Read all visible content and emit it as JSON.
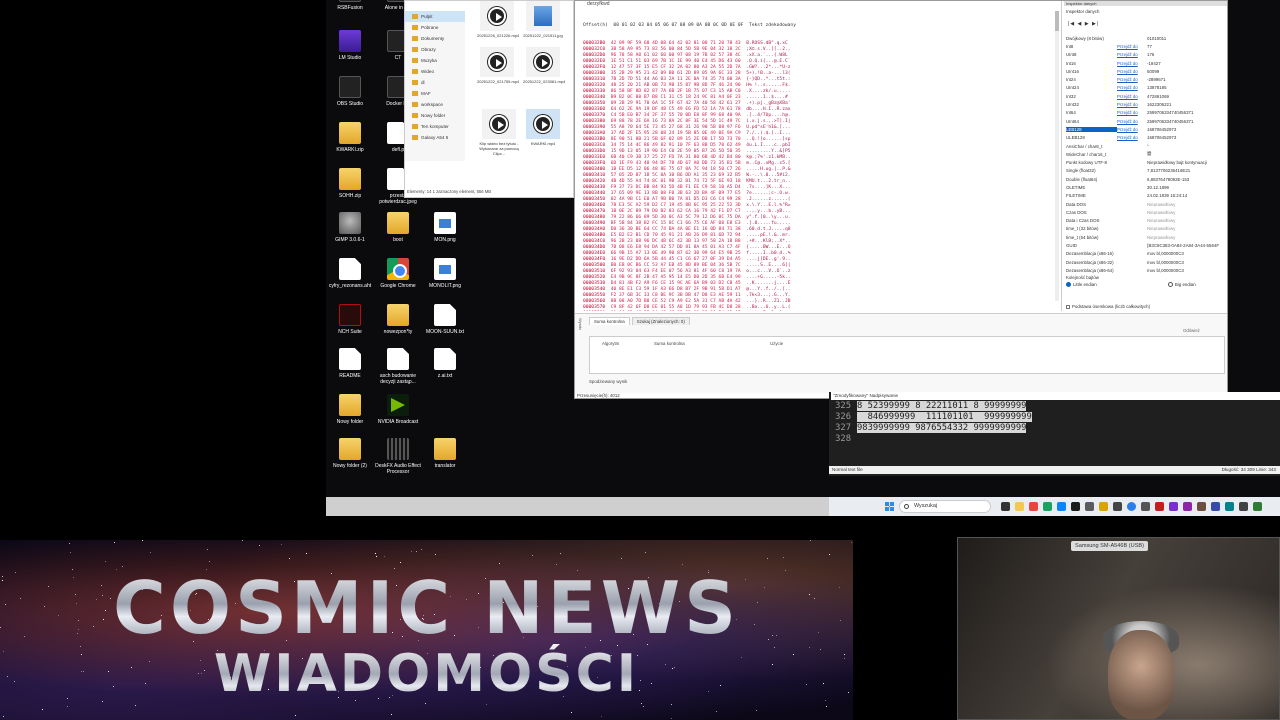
{
  "desktop": {
    "icons": [
      {
        "label": "RSBFusion",
        "kind": "dark"
      },
      {
        "label": "Alone in the",
        "kind": "dark"
      },
      {
        "label": "LM Studio",
        "kind": "purple"
      },
      {
        "label": "CT",
        "kind": "dark"
      },
      {
        "label": "OBS Studio",
        "kind": "dark"
      },
      {
        "label": "Docker De",
        "kind": "dark"
      },
      {
        "label": "KWARKI.zip",
        "kind": "folder"
      },
      {
        "label": "defl.p",
        "kind": "doc"
      },
      {
        "label": "SOHH.zip",
        "kind": "folder"
      },
      {
        "label": "przesta potwierdzac.jpeg",
        "kind": "doc"
      },
      {
        "label": "GIMP 3.0.6-1",
        "kind": "gimp"
      },
      {
        "label": "boot",
        "kind": "folder"
      },
      {
        "label": "MON.png",
        "kind": "img"
      },
      {
        "label": "cyfry_rezonans.aht",
        "kind": "doc"
      },
      {
        "label": "Google Chrome",
        "kind": "chrome"
      },
      {
        "label": "MONOLIT.png",
        "kind": "img"
      },
      {
        "label": "NCH Suite",
        "kind": "red"
      },
      {
        "label": "nowezpon*ty",
        "kind": "folder"
      },
      {
        "label": "MOON-SUUN.txt",
        "kind": "doc"
      },
      {
        "label": "README",
        "kind": "doc"
      },
      {
        "label": "asch budowanie decyzji zastąp...",
        "kind": "doc"
      },
      {
        "label": "z.ai.txt",
        "kind": "doc"
      },
      {
        "label": "Nowy folder",
        "kind": "folder"
      },
      {
        "label": "NVIDIA Broadcast",
        "kind": "green"
      },
      {
        "label": "Nowy folder (2)",
        "kind": "folder"
      },
      {
        "label": "DeskFX Audio Effect Processor",
        "kind": "eq"
      },
      {
        "label": "translator",
        "kind": "folder"
      }
    ]
  },
  "explorer": {
    "nav": [
      "Pulpit",
      "Pobrane",
      "Dokumenty",
      "Obrazy",
      "Muzyka",
      "Wideo",
      "dl",
      "MAF",
      "workspace",
      "Nowy folder",
      "Ten komputer",
      "Galaxy A54 5"
    ],
    "files": [
      {
        "label": "20251226_021226.mp4",
        "kind": "video"
      },
      {
        "label": "20251222_021511.jpg",
        "kind": "image"
      },
      {
        "label": "20251222_021755.mp4",
        "kind": "video"
      },
      {
        "label": "20251222_023081.mp4",
        "kind": "video"
      },
      {
        "label": "Klip wideo bez tytułu - Wykonane za pomocą Clipc...",
        "kind": "video"
      },
      {
        "label": "KWARKI.mp4",
        "kind": "video"
      }
    ],
    "status": "Elementy: 14    1 zaznaczony element, 556 MB"
  },
  "hexeditor": {
    "title": "derzyfkwd",
    "header": "Offset(h)  00 01 02 03 04 05 06 07 08 09 0A 0B 0C 0D 0E 0F  Tekst zdekodowany",
    "rows": [
      {
        "off": "000032B0",
        "hex": "42 09 9F 59 60 4D 08 64 42 02 81 00 71 20 78 43",
        "txt": "B.ROSS.dB\".q.xC"
      },
      {
        "off": "000032C0",
        "hex": "3B 58 A9 95 73 82 56 00 84 5D 5B 9E 04 32 18 2C",
        "txt": ";X©.s.V..][..2.,"
      },
      {
        "off": "000032D0",
        "hex": "96 78 58 A0 61 02 60 00 97 08 19 7B 02 57 38 4C",
        "txt": ".xX.a.`...{.W8L"
      },
      {
        "off": "000032E0",
        "hex": "1E 51 C1 51 03 69 7B 1C 1E 99 40 E4 45 D6 43 60",
        "txt": ".Q.Q.i{...@.E.C`"
      },
      {
        "off": "000032F0",
        "hex": "12 47 57 3F 15 E5 CF 32 2A 02 80 A3 2A 55 2D 7A",
        "txt": ".GW?...2*...*U-z"
      },
      {
        "off": "00003300",
        "hex": "35 2B 29 95 21 42 09 B0 61 2D 89 05 9A 6C 33 28",
        "txt": "5+).!B..a-...l3("
      },
      {
        "off": "00003310",
        "hex": "7B 2D 7D 51 44 A6 03 2A 11 2E 0A 74 35 74 00 3A",
        "txt": "{-}QD..*...t5t.:"
      },
      {
        "off": "00003320",
        "hex": "48 25 20 21 AB 0B 73 9B 15 87 9B 8D 7F 46 24 90",
        "txt": "H% !..s......F$."
      },
      {
        "off": "00003330",
        "hex": "86 58 BF 8D 82 87 7A 6B 2F 1B 75 07 C3 15 AB C0",
        "txt": ".X....zk/.u....."
      },
      {
        "off": "00003340",
        "hex": "B9 B2 0C 88 B7 B8 C1 31 C5 18 24 9C 81 A4 0F 23",
        "txt": "......1..$....#"
      },
      {
        "off": "00003350",
        "hex": "09 2B 29 91 70 6A 1C 5F 67 42 7A 40 58 42 61 27",
        "txt": ".+).pj._gBz@XBa'"
      },
      {
        "off": "00003360",
        "hex": "64 62 2E 9A 19 DF 48 C5 49 E6 FD 52 1A 7A 61 78",
        "txt": "db....H.I..R.zax"
      },
      {
        "off": "00003370",
        "hex": "C4 5B E0 B7 34 2F 37 55 70 0D E8 8F 99 68 40 9A",
        "txt": ".[..4/7Up....h@."
      },
      {
        "off": "00003380",
        "hex": "69 88 78 2E 6A 16 73 8A 2C 8F 3E 54 5D 1C 49 7C",
        "txt": "i.x.j.s.,.>T].I|"
      },
      {
        "off": "00003390",
        "hex": "55 A8 70 64 5E 73 45 27 68 31 26 90 5B 08 97 F6",
        "txt": "U.pd^sE'h1&.[..."
      },
      {
        "off": "000033A0",
        "hex": "37 AD 2F E5 95 28 08 24 19 5B 85 0E 49 0E 9A C9",
        "txt": "7./..(.$.[..I..."
      },
      {
        "off": "000033B0",
        "hex": "8E 90 51 8B 21 5B 6F 02 89 15 2E DB 17 5D 73 70",
        "txt": "..Q.![o......]sp"
      },
      {
        "off": "000033C0",
        "hex": "34 75 14 4C 86 49 82 91 10 7F 63 8B D5 70 62 49",
        "txt": "4u.L.I....c..pbI"
      },
      {
        "off": "000033D0",
        "hex": "15 9D 13 05 19 90 E4 C0 2E 59 05 B7 26 5D 50 35",
        "txt": ".........Y..&]P5"
      },
      {
        "off": "000033E0",
        "hex": "6B 40 C9 3B 37 25 27 FD 7A 31 80 6B 4D 42 B4 80",
        "txt": "k@.;7%'.z1.kMB.."
      },
      {
        "off": "000033F0",
        "hex": "6D 1E F9 43 40 94 DF 78 4D 67 A0 DD 73 35 B1 5B",
        "txt": "m..C@..xMg..s5.["
      },
      {
        "off": "00003400",
        "hex": "1B EE D5 12 06 48 8E 75 67 0A 7C 94 18 50 C7 26",
        "txt": ".....H.ug.|..P.&"
      },
      {
        "off": "00003410",
        "hex": "57 05 2D 87 18 5C 0A 30 B6 DD A1 35 23 69 32 B5",
        "txt": "W.-..\\.0...5#i2."
      },
      {
        "off": "00003420",
        "hex": "4B 4D 55 A4 74 8C 01 9B 32 B1 74 72 5F 6E 93 18",
        "txt": "KMU.t...2.tr_n.."
      },
      {
        "off": "00003430",
        "hex": "F9 37 73 DC BB 84 93 5D 4B F1 EE C9 58 10 A5 D4",
        "txt": ".7s....]K...X..."
      },
      {
        "off": "00003440",
        "hex": "37 65 09 9E 13 8B 08 F0 3B 63 2D BA 4F 09 77 E5",
        "txt": "7e......;c-.O.w."
      },
      {
        "off": "00003450",
        "hex": "02 4A 9B C1 E0 A7 9B B0 7A 81 D5 D3 C6 C4 99 28",
        "txt": ".J......z......("
      },
      {
        "off": "00003460",
        "hex": "78 E3 5C A2 59 D2 C7 19 45 8B 6C 95 25 22 52 3D",
        "txt": "x.\\.Y...E.l.%\"R="
      },
      {
        "off": "00003470",
        "hex": "1B 0E 2C 89 79 D0 B2 83 62 CA 16 79 42 F1 D7 C7",
        "txt": "..,.y...b..yB..."
      },
      {
        "off": "00003480",
        "hex": "79 22 86 66 89 5D 30 0C A3 5C 79 12 D6 0C 75 DA",
        "txt": "y\".f.]0..\\y...u."
      },
      {
        "off": "00003490",
        "hex": "BF 5B 84 38 B2 FC 15 8C C1 66 75 C6 AF 08 E8 E3",
        "txt": ".[.8.....fu....."
      },
      {
        "off": "000034A0",
        "hex": "D0 36 30 BE 64 CC 74 BA 4A 0E E1 16 0D 84 71 38",
        "txt": ".60.d.t.J.....q8"
      },
      {
        "off": "000034B0",
        "hex": "E5 B2 E2 B1 CD 70 45 91 21 AB 26 D9 81 6D 72 94",
        "txt": ".....pE.!.&..mr."
      },
      {
        "off": "000034C0",
        "hex": "96 2B 23 88 96 DC 4B 6C 42 3B 13 97 58 2A 18 B8",
        "txt": ".+#...KlB;..X*.."
      },
      {
        "off": "000034D0",
        "hex": "7B 08 E6 E8 94 DA 42 57 DD 81 8A 45 01 A3 C7 4F",
        "txt": "{.....BW...E...O"
      },
      {
        "off": "000034E0",
        "hex": "66 9B 15 A7 13 0E 49 90 87 62 30 99 64 E5 9B 25",
        "txt": "f.....I..b0.d..%"
      },
      {
        "off": "000034F0",
        "hex": "16 9E D2 DD 6A 5B 44 45 C1 C6 67 27 0F 39 D4 A5",
        "txt": "....j[DE..g'.9.."
      },
      {
        "off": "00003500",
        "hex": "B0 EB 0C B6 CC 53 A7 EB 45 8D 89 BE 04 36 5B 7C",
        "txt": ".....S..E....6[|"
      },
      {
        "off": "00003510",
        "hex": "6F 92 93 04 63 F4 EE 07 56 A3 81 4F 60 C8 19 7A",
        "txt": "o...c...V..O`..z"
      },
      {
        "off": "00003520",
        "hex": "E4 9B 9C 8F 2B 47 A5 95 14 E5 D0 2D 35 6B E4 99",
        "txt": "....+G.....-5k.."
      },
      {
        "off": "00003530",
        "hex": "D4 81 4B F2 A9 F6 CE 15 9C AE 6A B9 03 D2 C8 45",
        "txt": "..K.......j....E"
      },
      {
        "off": "00003540",
        "hex": "40 8E E1 C3 59 1F A3 66 D8 B7 2F 9B 91 5B D1 A7",
        "txt": "@...Y..f../..[.."
      },
      {
        "off": "00003550",
        "hex": "F2 37 6B 3C 33 C8 BE 9C 3B DB 47 D8 E3 AE 59 11",
        "txt": ".7k<3...;.G...Y."
      },
      {
        "off": "00003560",
        "hex": "8B 08 A0 7D B0 CE 52 C9 A9 E2 5A 31 C7 AB 4A 42",
        "txt": "...}..R...Z1..JB"
      },
      {
        "off": "00003570",
        "hex": "C9 8F 42 6F D8 EE 01 55 A8 1D 79 93 FB 4C D8 28",
        "txt": "..Bo...U..y..L.("
      },
      {
        "off": "00003580",
        "hex": "01 06 3D 4C E7 9A 45 CC 8D 33 82 3E 31 E4 6D A7",
        "txt": "..=L..E..3.>1.m."
      },
      {
        "off": "00003590",
        "hex": "F0 4B 6E 37 9B 7D 95 F2 C2 D7 3E 1B 2E 90 1D 08",
        "txt": ".Kn7.}....>....."
      },
      {
        "off": "000035A0",
        "hex": "64 F9 18 CB 39 E5 34 9E 6B 8D A3 58 F0 01 B2 EA",
        "txt": "d...9.4.k..X...."
      },
      {
        "off": "000035B0",
        "hex": "D7 AE 50 98 06 93 15 44 DE 1A 71 A9 C5 2D 6F 3E",
        "txt": "..P....D..q..-o>"
      },
      {
        "off": "000035C0",
        "hex": "39 04 E5 FE 92 35 43 D7 62 8E 31 07 0A B9 CC 23",
        "txt": "9....5C.b.1....#"
      }
    ],
    "inspector": {
      "title": "Inspektor danych",
      "subtitle": "Inspektor danych",
      "nav": "|◀ ◀ ▶ ▶|",
      "rows": [
        {
          "k": "Dwójkowy (8 bitów)",
          "a": "",
          "v": "01010011",
          "sel": false,
          "dim": false
        },
        {
          "k": "Int8",
          "a": "Przejdź do",
          "v": "77",
          "sel": false,
          "dim": false
        },
        {
          "k": "UInt8",
          "a": "Przejdź do",
          "v": "176",
          "sel": false,
          "dim": false
        },
        {
          "k": "Int16",
          "a": "Przejdź do",
          "v": "-19427",
          "sel": false,
          "dim": false
        },
        {
          "k": "UInt16",
          "a": "Przejdź do",
          "v": "50099",
          "sel": false,
          "dim": false
        },
        {
          "k": "Int24",
          "a": "Przejdź do",
          "v": "-2899671",
          "sel": false,
          "dim": false
        },
        {
          "k": "UInt24",
          "a": "Przejdź do",
          "v": "13878185",
          "sel": false,
          "dim": false
        },
        {
          "k": "Int32",
          "a": "Przejdź do",
          "v": "472861069",
          "sel": false,
          "dim": false
        },
        {
          "k": "UInt32",
          "a": "Przejdź do",
          "v": "1622306221",
          "sel": false,
          "dim": false
        },
        {
          "k": "Int64",
          "a": "Przejdź do",
          "v": "2599706334740456371",
          "sel": false,
          "dim": false
        },
        {
          "k": "UInt64",
          "a": "Przejdź do",
          "v": "2599706334740456371",
          "sel": false,
          "dim": false
        },
        {
          "k": "LEB128",
          "a": "Przejdź do",
          "v": "168706452973",
          "sel": true,
          "dim": false
        },
        {
          "k": "ULEB128",
          "a": "Przejdź do",
          "v": "168706452973",
          "sel": false,
          "dim": false
        },
        {
          "k": "AnsiChar / char8_t",
          "a": "",
          "v": "°",
          "sel": false,
          "dim": false
        },
        {
          "k": "WideChar / char16_t",
          "a": "",
          "v": "嶜",
          "sel": false,
          "dim": false
        },
        {
          "k": "Punkt kodowy UTF-8",
          "a": "",
          "v": "Nieprawidłowy bajt kontynuacji",
          "sel": false,
          "dim": false
        },
        {
          "k": "Single (float32)",
          "a": "",
          "v": "7,8137706236416E21",
          "sel": false,
          "dim": false
        },
        {
          "k": "Double (float64)",
          "a": "",
          "v": "6,88376478092E-153",
          "sel": false,
          "dim": false
        },
        {
          "k": "OLETIME",
          "a": "",
          "v": "30.12.1899",
          "sel": false,
          "dim": false
        },
        {
          "k": "FILETIME",
          "a": "",
          "v": "24.02.1839 16:24:14",
          "sel": false,
          "dim": false
        },
        {
          "k": "Data DOS",
          "a": "",
          "v": "Nieprawidłowy",
          "sel": false,
          "dim": true
        },
        {
          "k": "Czas DOS",
          "a": "",
          "v": "Nieprawidłowy",
          "sel": false,
          "dim": true
        },
        {
          "k": "Data i Czas DOS",
          "a": "",
          "v": "Nieprawidłowy",
          "sel": false,
          "dim": true
        },
        {
          "k": "time_t (32 bitów)",
          "a": "",
          "v": "Nieprawidłowy",
          "sel": false,
          "dim": true
        },
        {
          "k": "time_t (64 bitów)",
          "a": "",
          "v": "Nieprawidłowy",
          "sel": false,
          "dim": true
        },
        {
          "k": "GUID",
          "a": "",
          "v": "{B3C8C383-0A84-2A84-3A44-5564F",
          "sel": false,
          "dim": false
        },
        {
          "k": "Dezasemblacja (x86-16)",
          "a": "",
          "v": "mov bl,0000000C3",
          "sel": false,
          "dim": false
        },
        {
          "k": "Dezasemblacja (x86-32)",
          "a": "",
          "v": "mov bl,0000000C3",
          "sel": false,
          "dim": false
        },
        {
          "k": "Dezasemblacja (x86-64)",
          "a": "",
          "v": "mov bl,0000000C3",
          "sel": false,
          "dim": false
        }
      ],
      "byte_order_label": "Kolejność bajtów",
      "little_endian": "Little endian",
      "big_endian": "Big endian",
      "signed_label": "Podstawa ósemkowa (liczb całkowitych)"
    },
    "bottom": {
      "vertical_label": "Wyniki",
      "tab_checksum": "Suma kontrolna",
      "tab_search": "Szukaj (Znalezionych: 0)",
      "col_algorithm": "Algorytm",
      "col_checksum": "Suma kontrolna",
      "col_file": "Użycie",
      "reset": "Odśwież",
      "planned": "Spodziewany wynik"
    },
    "status": "Przesunięcie(h): 4012"
  },
  "texteditor": {
    "title": "\"Zmodyfikowany\" Nadpisywanie",
    "lines": [
      {
        "n": "325",
        "c": "8 52399999 8 22211011 8 99999999"
      },
      {
        "n": "326",
        "c": "  846999999  111101101  999999999"
      },
      {
        "n": "327",
        "c": "9839999999 9876554332 9999999999"
      },
      {
        "n": "328",
        "c": ""
      }
    ],
    "status_left": "Normal text file",
    "status_right": "Długość: 34 309    Linie: 343"
  },
  "taskbar": {
    "search": "Wyszukaj"
  },
  "banner": {
    "title": "COSMIC NEWS",
    "subtitle": "WIADOMOŚCI"
  },
  "webcam": {
    "label": "Samsung SM-A546B (USB)"
  }
}
